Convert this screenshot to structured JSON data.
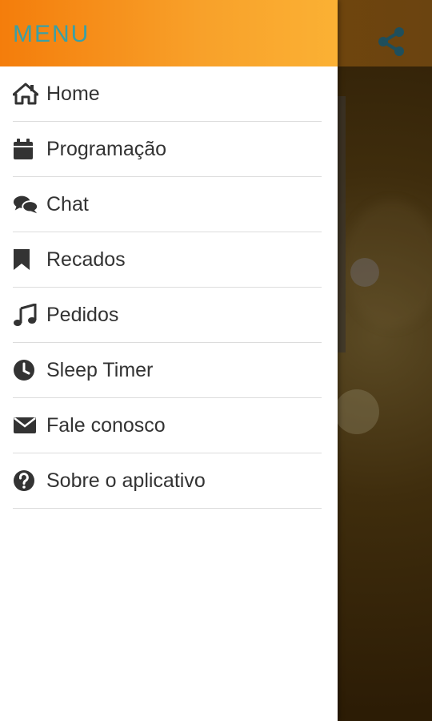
{
  "drawer": {
    "title": "MENU",
    "items": [
      {
        "label": "Home",
        "icon": "home-icon"
      },
      {
        "label": "Programação",
        "icon": "calendar-icon"
      },
      {
        "label": "Chat",
        "icon": "chat-icon"
      },
      {
        "label": "Recados",
        "icon": "bookmark-icon"
      },
      {
        "label": "Pedidos",
        "icon": "music-icon"
      },
      {
        "label": "Sleep Timer",
        "icon": "clock-icon"
      },
      {
        "label": "Fale conosco",
        "icon": "envelope-icon"
      },
      {
        "label": "Sobre o aplicativo",
        "icon": "question-icon"
      }
    ]
  },
  "toolbar": {
    "share_icon": "share-icon"
  },
  "colors": {
    "header_start": "#f47d0b",
    "header_end": "#fbb134",
    "title": "#3aa0a6",
    "icon": "#333333",
    "share_icon": "#1f4f5c"
  }
}
